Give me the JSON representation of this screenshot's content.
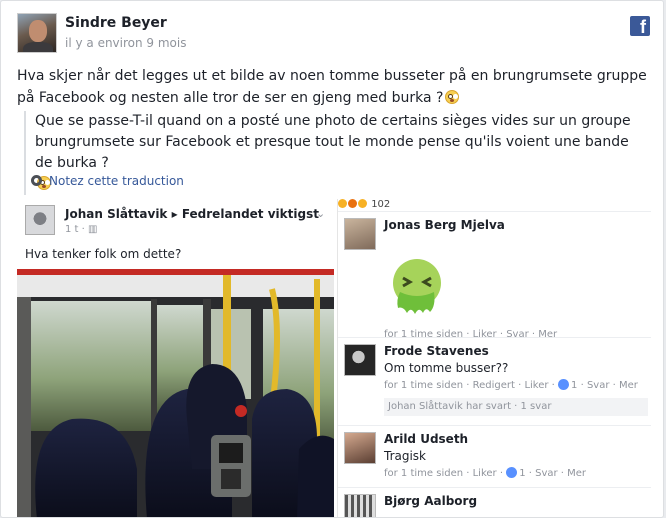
{
  "post": {
    "author": "Sindre Beyer",
    "time": "il y a environ 9 mois",
    "network_icon": "facebook-icon",
    "text": "Hva skjer når det legges ut et bilde av noen tomme busseter på en brungrumsete gruppe på Facebook og nesten alle tror de ser en gjeng med burka ?",
    "translation": "Que se passe-T-il quand on a posté une photo de certains sièges vides sur un groupe brungrumsete sur Facebook et presque tout le monde pense qu'ils voient une bande de burka ?",
    "translation_link": "Notez cette traduction"
  },
  "embedded": {
    "original_post": {
      "author": "Johan Slåttavik",
      "group": "Fedrelandet viktigst",
      "meta": "1 t · ",
      "text": "Hva tenker folk om dette?"
    },
    "reaction_count": "102",
    "comments": [
      {
        "name": "Jonas Berg Mjelva",
        "text": "",
        "sticker": "sick-face-sticker",
        "meta": "for 1 time siden · Liker · Svar · Mer"
      },
      {
        "name": "Frode Stavenes",
        "text": "Om tomme busser??",
        "meta_before_count": "for 1 time siden · Redigert · Liker · ",
        "like_count": "1",
        "meta_after_count": " · Svar · Mer",
        "reply_summary": "Johan Slåttavik har svart · 1 svar"
      },
      {
        "name": "Arild Udseth",
        "text": "Tragisk",
        "meta_before_count": "for 1 time siden · Liker · ",
        "like_count": "1",
        "meta_after_count": " · Svar · Mer"
      },
      {
        "name": "Bjørg Aalborg",
        "text": "",
        "meta": ""
      }
    ]
  }
}
